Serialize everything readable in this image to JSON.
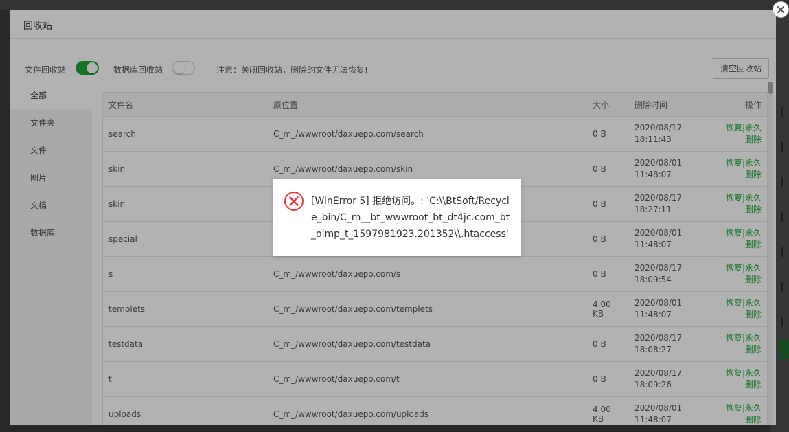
{
  "dialog": {
    "title": "回收站",
    "toolbar": {
      "file_recycle_label": "文件回收站",
      "file_recycle_on": true,
      "db_recycle_label": "数据库回收站",
      "db_recycle_on": false,
      "notice": "注意：关闭回收站，删除的文件无法恢复!",
      "clear_button": "清空回收站"
    },
    "sidebar": {
      "items": [
        {
          "label": "全部",
          "active": true
        },
        {
          "label": "文件夹"
        },
        {
          "label": "文件"
        },
        {
          "label": "图片"
        },
        {
          "label": "文档"
        },
        {
          "label": "数据库"
        }
      ]
    },
    "table": {
      "headers": {
        "name": "文件名",
        "location": "原位置",
        "size": "大小",
        "time": "删除时间",
        "ops": "操作"
      },
      "rows": [
        {
          "name": "search",
          "location": "C_m_/wwwroot/daxuepo.com/search",
          "size": "0 B",
          "date": "2020/08/17",
          "clock": "18:11:43"
        },
        {
          "name": "skin",
          "location": "C_m_/wwwroot/daxuepo.com/skin",
          "size": "0 B",
          "date": "2020/08/01",
          "clock": "11:48:07"
        },
        {
          "name": "skin",
          "location": "",
          "size": "0 B",
          "date": "2020/08/17",
          "clock": "18:27:11"
        },
        {
          "name": "special",
          "location": "",
          "size": "0 B",
          "date": "2020/08/01",
          "clock": "11:48:07"
        },
        {
          "name": "s",
          "location": "C_m_/wwwroot/daxuepo.com/s",
          "size": "0 B",
          "date": "2020/08/17",
          "clock": "18:09:54"
        },
        {
          "name": "templets",
          "location": "C_m_/wwwroot/daxuepo.com/templets",
          "size": "4.00 KB",
          "date": "2020/08/01",
          "clock": "11:48:07"
        },
        {
          "name": "testdata",
          "location": "C_m_/wwwroot/daxuepo.com/testdata",
          "size": "0 B",
          "date": "2020/08/17",
          "clock": "18:08:27"
        },
        {
          "name": "t",
          "location": "C_m_/wwwroot/daxuepo.com/t",
          "size": "0 B",
          "date": "2020/08/17",
          "clock": "18:09:26"
        },
        {
          "name": "uploads",
          "location": "C_m_/wwwroot/daxuepo.com/uploads",
          "size": "4.00 KB",
          "date": "2020/08/01",
          "clock": "11:48:07"
        }
      ],
      "ops": {
        "restore": "恢复",
        "separator": "|",
        "delete_line1": "永久",
        "delete_line2": "删除"
      }
    }
  },
  "error_message": {
    "icon": "error-circle-icon",
    "text": "[WinError 5] 拒绝访问。: 'C:\\\\BtSoft/Recycle_bin/C_m__bt_wwwroot_bt_dt4jc.com_bt_olmp_t_1597981923.201352\\\\.htaccess'"
  },
  "colors": {
    "accent": "#20a53a",
    "error": "#e53935",
    "overlay": "rgba(0,0,0,0.3)"
  }
}
